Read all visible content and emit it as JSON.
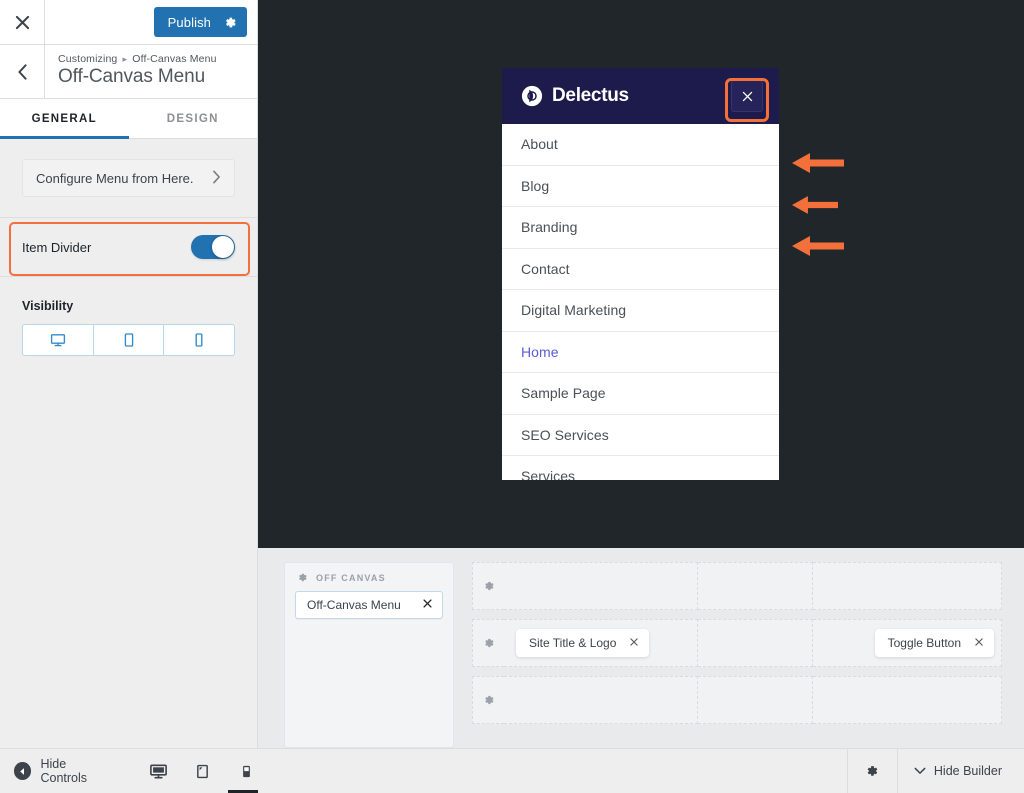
{
  "customizer": {
    "close_icon": "close-icon",
    "publish_label": "Publish",
    "publish_gear_icon": "gear-icon",
    "back_icon": "chevron-left-icon",
    "breadcrumb_parent": "Customizing",
    "breadcrumb_sep": "▸",
    "breadcrumb_current": "Off-Canvas Menu",
    "page_title": "Off-Canvas Menu",
    "tabs": [
      {
        "label": "GENERAL",
        "active": true
      },
      {
        "label": "DESIGN",
        "active": false
      }
    ],
    "configure_label": "Configure Menu from Here.",
    "configure_chevron": "chevron-right-icon",
    "item_divider": {
      "label": "Item Divider",
      "toggle_state": "on",
      "highlight_color": "#f4703b"
    },
    "visibility": {
      "label": "Visibility",
      "options": [
        {
          "icon": "desktop-icon",
          "name": "desktop"
        },
        {
          "icon": "tablet-icon",
          "name": "tablet"
        },
        {
          "icon": "mobile-icon",
          "name": "mobile"
        }
      ]
    },
    "bottom": {
      "hide_controls_label": "Hide Controls",
      "devices": [
        {
          "icon": "desktop-icon",
          "name": "desktop",
          "active": false
        },
        {
          "icon": "tablet-icon",
          "name": "tablet",
          "active": false
        },
        {
          "icon": "mobile-icon",
          "name": "mobile",
          "active": true
        }
      ]
    }
  },
  "preview": {
    "background": "#21262b",
    "offcanvas": {
      "brand_name": "Delectus",
      "logo_icon": "delectus-circle-logo",
      "header_bg": "#1d1b4b",
      "close_icon": "close-icon",
      "close_highlight_color": "#f4703b",
      "items": [
        {
          "label": "About",
          "current": false
        },
        {
          "label": "Blog",
          "current": false
        },
        {
          "label": "Branding",
          "current": false
        },
        {
          "label": "Contact",
          "current": false
        },
        {
          "label": "Digital Marketing",
          "current": false
        },
        {
          "label": "Home",
          "current": true
        },
        {
          "label": "Sample Page",
          "current": false
        },
        {
          "label": "SEO Services",
          "current": false
        },
        {
          "label": "Services",
          "current": false
        }
      ]
    },
    "annotation_arrows": {
      "color": "#f4703b",
      "count": 3,
      "direction": "left"
    }
  },
  "builder": {
    "left_panel": {
      "gear_icon": "gear-icon",
      "title": "OFF CANVAS",
      "chip_label": "Off-Canvas Menu",
      "chip_remove_icon": "close-icon"
    },
    "rows": [
      {
        "gear_icon": "gear-icon",
        "modules": []
      },
      {
        "gear_icon": "gear-icon",
        "modules": [
          {
            "label": "Site Title & Logo",
            "remove_icon": "close-icon",
            "cell": 1
          },
          {
            "label": "Toggle Button",
            "remove_icon": "close-icon",
            "cell": 3
          }
        ]
      },
      {
        "gear_icon": "gear-icon",
        "modules": []
      }
    ]
  },
  "bottom_bar": {
    "gear_icon": "gear-icon",
    "hide_builder_label": "Hide Builder",
    "hide_builder_chevron": "chevron-down-icon"
  }
}
